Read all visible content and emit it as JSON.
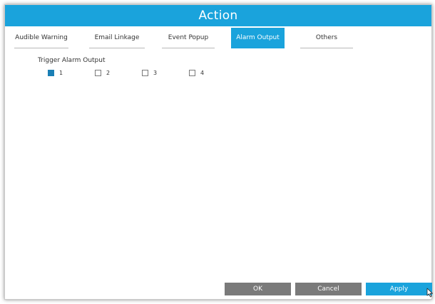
{
  "dialog": {
    "title": "Action"
  },
  "tabs": [
    {
      "label": "Audible Warning",
      "active": false
    },
    {
      "label": "Email Linkage",
      "active": false
    },
    {
      "label": "Event Popup",
      "active": false
    },
    {
      "label": "Alarm Output",
      "active": true
    },
    {
      "label": "Others",
      "active": false
    }
  ],
  "alarm_output": {
    "label": "Trigger Alarm Output",
    "outputs": [
      {
        "label": "1",
        "checked": true
      },
      {
        "label": "2",
        "checked": false
      },
      {
        "label": "3",
        "checked": false
      },
      {
        "label": "4",
        "checked": false
      }
    ]
  },
  "buttons": {
    "ok": "OK",
    "cancel": "Cancel",
    "apply": "Apply"
  },
  "colors": {
    "accent": "#1aa3dc",
    "checked": "#1a7fb5",
    "button_gray": "#7a7a7a"
  },
  "icons": {
    "cursor": "mouse-pointer-icon"
  }
}
